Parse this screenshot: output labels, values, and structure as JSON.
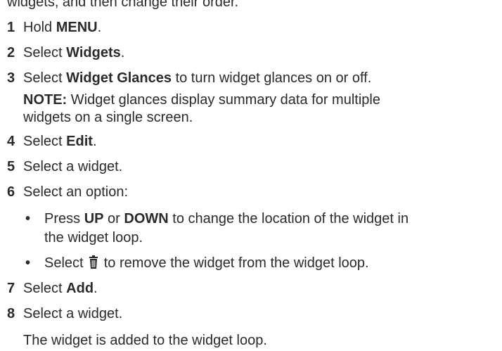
{
  "header_fragment": "widgets, and then change their order.",
  "steps": [
    {
      "num": "1",
      "pre": "Hold ",
      "bold": "MENU",
      "post": "."
    },
    {
      "num": "2",
      "pre": "Select ",
      "bold": "Widgets",
      "post": "."
    },
    {
      "num": "3",
      "pre": "Select ",
      "bold": "Widget Glances",
      "post": " to turn widget glances on or off."
    },
    {
      "num": "4",
      "pre": "Select ",
      "bold": "Edit",
      "post": "."
    },
    {
      "num": "5",
      "text": "Select a widget."
    },
    {
      "num": "6",
      "text": "Select an option:"
    },
    {
      "num": "7",
      "pre": "Select ",
      "bold": "Add",
      "post": "."
    },
    {
      "num": "8",
      "text": "Select a widget."
    }
  ],
  "note": {
    "label": "NOTE:",
    "line1": " Widget glances display summary data for multiple",
    "line2": "widgets on a single screen."
  },
  "options": [
    {
      "p1": "Press ",
      "b1": "UP",
      "p2": " or ",
      "b2": "DOWN",
      "p3": " to change the location of the widget in",
      "line2": "the widget loop."
    },
    {
      "pre": "Select ",
      "icon": "trash-icon",
      "post": " to remove the widget from the widget loop."
    }
  ],
  "result": "The widget is added to the widget loop."
}
